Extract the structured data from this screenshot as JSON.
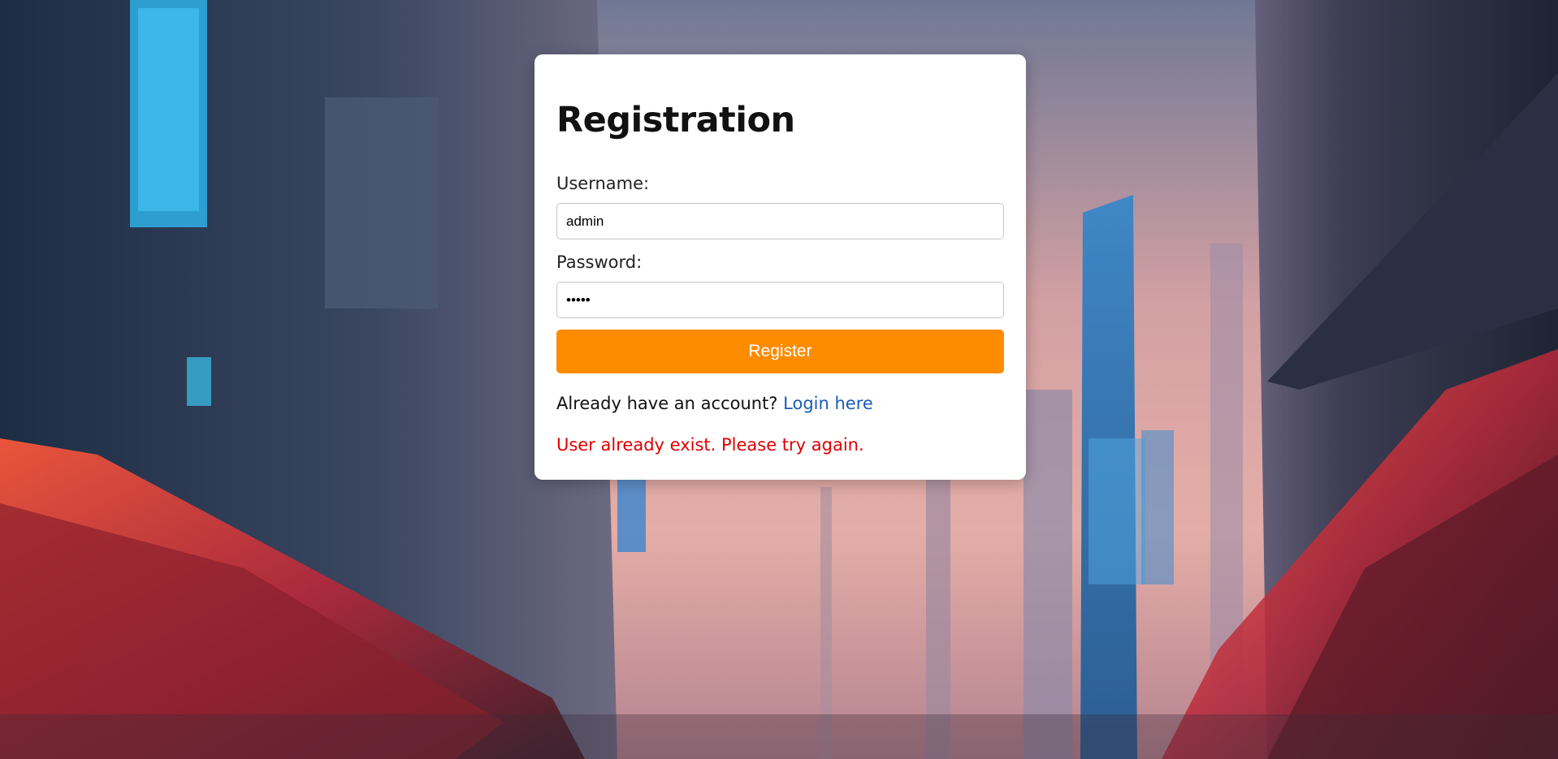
{
  "form": {
    "title": "Registration",
    "username_label": "Username:",
    "username_value": "admin",
    "password_label": "Password:",
    "password_value": "admin",
    "register_label": "Register",
    "account_prompt": "Already have an account?",
    "login_link": "Login here",
    "error_message": "User already exist. Please try again."
  },
  "colors": {
    "button": "#ff8c00",
    "link": "#1a5bb8",
    "error": "#e00000"
  }
}
